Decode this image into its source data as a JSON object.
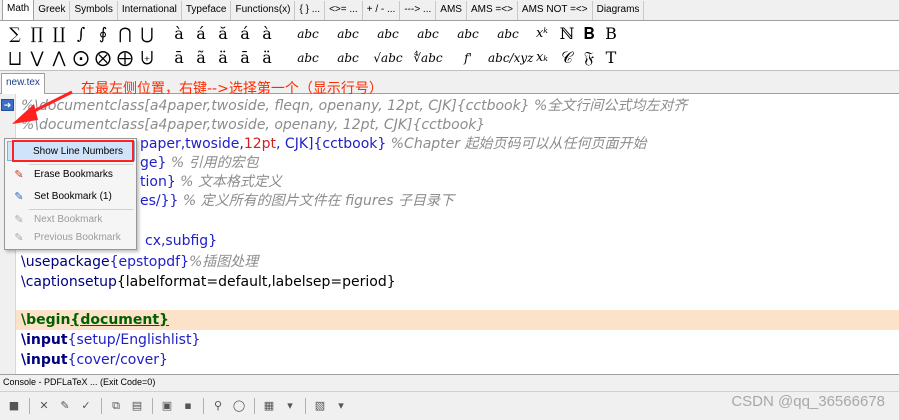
{
  "symbol_tabs": [
    "Math",
    "Greek",
    "Symbols",
    "International",
    "Typeface",
    "Functions(x)",
    "{ } ...",
    "<>= ...",
    "+ / - ...",
    "---> ...",
    "AMS",
    "AMS =<>",
    "AMS NOT =<>",
    "Diagrams"
  ],
  "symbols_row1": [
    "∑",
    "∏",
    "∐",
    "∫",
    "∮",
    "⋂",
    "⋃",
    "à",
    "á",
    "ă",
    "á",
    "à",
    "abc",
    "abc",
    "abc",
    "abc",
    "abc",
    "abc",
    "xᵏ",
    "ℕ",
    "𝐁",
    "B"
  ],
  "symbols_row2": [
    "⨆",
    "⋁",
    "⋀",
    "⨀",
    "⨂",
    "⨁",
    "⨄",
    "ā",
    "ã",
    "ä",
    "ā",
    "ä",
    "abc",
    "abc",
    "√abc",
    "∜abc",
    "f'",
    "abc/xyz",
    "xₖ",
    "𝒞",
    "𝔉",
    "T"
  ],
  "file_tab": "new.tex",
  "annotation": "在最左侧位置，右键-->选择第一个（显示行号）",
  "editor": {
    "line1": "%\\documentclass[a4paper,twoside, fleqn, openany, 12pt, CJK]{cctbook}  %全文行间公式均左对齐",
    "line2": "%\\documentclass[a4paper,twoside, openany, 12pt, CJK]{cctbook}",
    "line3_a": "paper,twoside,",
    "line3_num": "12pt",
    "line3_b": ", CJK]{cctbook}",
    "line3_cm": "  %Chapter 起始页码可以从任何页面开始",
    "line4_a": "ge}",
    "line4_cm": "   %  引用的宏包",
    "line5_a": "tion}",
    "line5_cm": "   %  文本格式定义",
    "line6_a": "es/}}",
    "line6_cm": "   %  定义所有的图片文件在 figures 子目录下",
    "line8_a": "cx,subfig}",
    "line9_cmd": "\\usepackage",
    "line9_arg": "{epstopdf}",
    "line9_cm": "%插图处理",
    "line10_cmd": "\\captionsetup",
    "line10_arg": "{labelformat=default,labelsep=period}",
    "line12_cmd": "\\begin",
    "line12_arg": "{document}",
    "line13_cmd": "\\input",
    "line13_arg": "{setup/Englishlist}",
    "line14_cmd": "\\input",
    "line14_arg": "{cover/cover}"
  },
  "context_menu": {
    "show_line_numbers": "Show Line Numbers",
    "erase_bookmarks": "Erase Bookmarks",
    "set_bookmark": "Set Bookmark (1)",
    "next_bookmark": "Next Bookmark",
    "previous_bookmark": "Previous Bookmark"
  },
  "console": "Console - PDFLaTeX ... (Exit Code=0)",
  "watermark": "CSDN @qq_36566678",
  "colors": {
    "accent": "#ff2a00",
    "highlight": "#fbe2c8",
    "menu_hover": "#cfe3fa"
  }
}
